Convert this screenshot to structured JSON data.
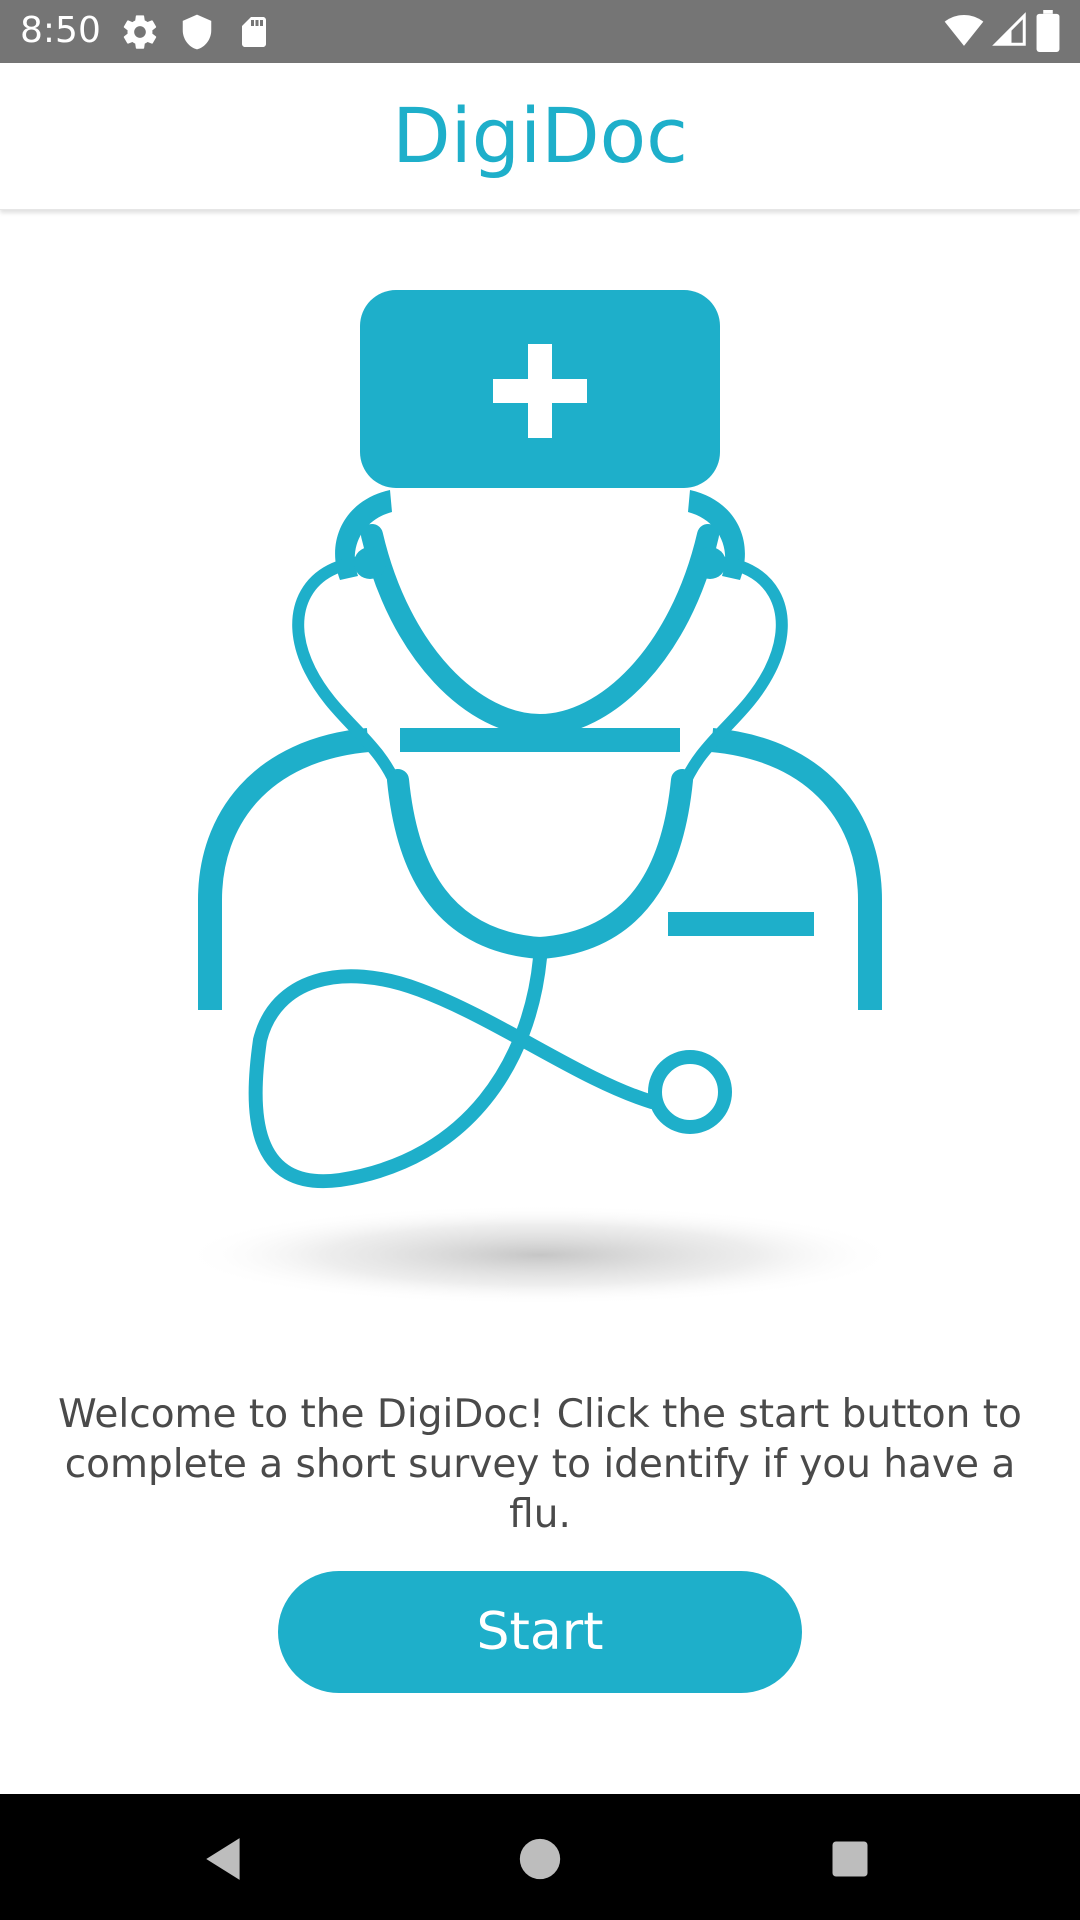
{
  "status_bar": {
    "time": "8:50",
    "left_icons": [
      "settings-icon",
      "shield-icon",
      "sd-card-icon"
    ],
    "right_icons": [
      "wifi-icon",
      "cell-signal-icon",
      "battery-icon"
    ],
    "background": "#757575"
  },
  "app_bar": {
    "title": "DigiDoc"
  },
  "main": {
    "illustration": "doctor-with-stethoscope",
    "welcome_text": "Welcome to the DigiDoc! Click the start button to complete a short survey to identify if you have a flu.",
    "start_label": "Start"
  },
  "nav_bar": {
    "icons": [
      "back-icon",
      "home-icon",
      "recents-icon"
    ]
  },
  "colors": {
    "accent": "#1eafca",
    "text": "#4a4a4a",
    "status_bar": "#757575",
    "nav_bar": "#000000"
  }
}
